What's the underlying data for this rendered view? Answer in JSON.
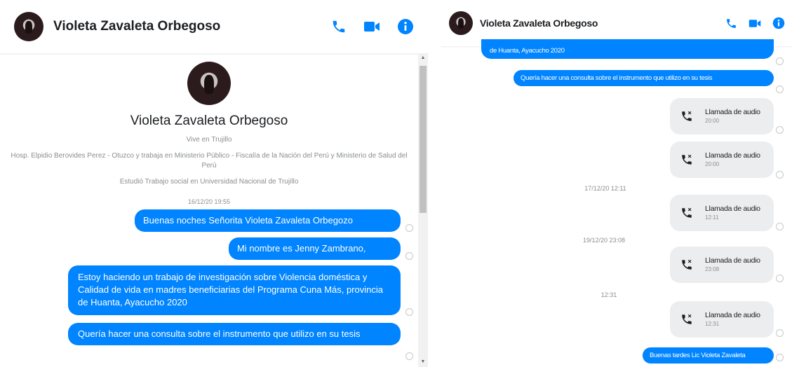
{
  "contact": {
    "name": "Violeta Zavaleta Orbegoso"
  },
  "header_icons": {
    "call": "phone-icon",
    "video": "video-icon",
    "info": "info-icon"
  },
  "colors": {
    "accent": "#0084ff",
    "bubble_text": "#ffffff",
    "call_card": "#ecedef",
    "muted": "#8a8d91"
  },
  "profile": {
    "name": "Violeta Zavaleta Orbegoso",
    "lives": "Vive en Trujillo",
    "work": "Hosp. Elpidio Berovides Perez - Otuzco y trabaja en Ministerio Público - Fiscalía de la Nación del Perú y Ministerio de Salud del Perú",
    "education": "Estudió Trabajo social en Universidad Nacional de Trujillo"
  },
  "left_chat": {
    "timestamp": "16/12/20 19:55",
    "messages": [
      "Buenas noches Señorita Violeta Zavaleta Orbegozo",
      "Mi nombre es Jenny Zambrano,",
      "Estoy haciendo un trabajo de investigación sobre Violencia doméstica y Calidad de vida en madres beneficiarias del Programa Cuna Más, provincia de Huanta, Ayacucho 2020",
      "Quería hacer una consulta sobre el instrumento que utilizo en su tesis"
    ]
  },
  "right_chat": {
    "top_message_partial": "de Huanta, Ayacucho 2020",
    "message_1": "Quería hacer una consulta sobre el instrumento que utilizo en su tesis",
    "calls": [
      {
        "title": "Llamada de audio",
        "time": "20:00"
      },
      {
        "title": "Llamada de audio",
        "time": "20:00"
      },
      {
        "title": "Llamada de audio",
        "time": "12:11"
      },
      {
        "title": "Llamada de audio",
        "time": "23:08"
      },
      {
        "title": "Llamada de audio",
        "time": "12:31"
      }
    ],
    "timestamps": [
      "17/12/20 12:11",
      "19/12/20 23:08",
      "12:31"
    ],
    "last_message": "Buenas tardes Lic Violeta Zavaleta"
  }
}
